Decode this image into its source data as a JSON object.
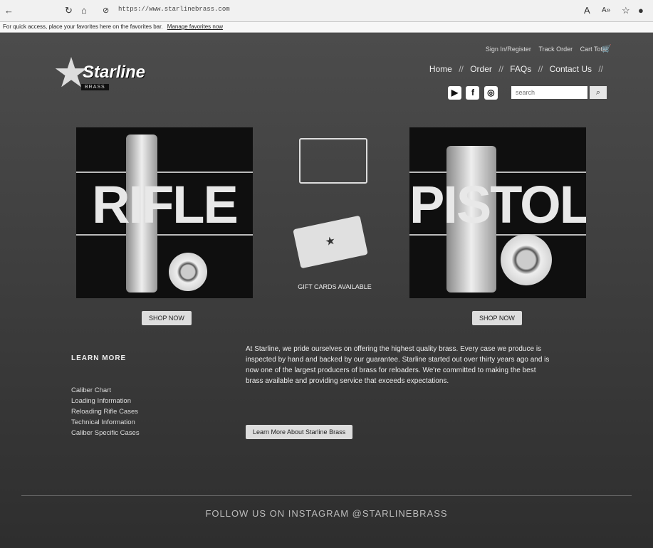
{
  "browser": {
    "back_icon": "arrow-left-icon",
    "reload_icon": "reload-icon",
    "home_icon": "home-icon",
    "url": "https://www.starlinebrass.com",
    "zoom_icon": "zoom-icon",
    "read_icon": "read-aloud-icon",
    "favorite_icon": "star-icon",
    "profile_icon": "profile-icon",
    "notice_text": "For quick access, place your favorites here on the favorites bar.",
    "notice_link": "Manage favorites now"
  },
  "header": {
    "account_links": [
      "Sign In/Register",
      "Track Order",
      "Cart Total"
    ],
    "nav": [
      "Home",
      "Order",
      "FAQs",
      "Contact Us"
    ],
    "nav_sep": "//",
    "social": [
      "youtube-icon",
      "facebook-icon",
      "instagram-icon"
    ],
    "search_placeholder": "search"
  },
  "logo": {
    "brand": "Starline",
    "tagline": "BRASS"
  },
  "products": {
    "rifle_word": "RIFLE",
    "pistol_word": "PISTOL",
    "shop_label": "SHOP NOW",
    "gift_caption": "GIFT CARDS AVAILABLE"
  },
  "learn_more": {
    "heading": "LEARN MORE",
    "items": [
      "Caliber Chart",
      "Loading Information",
      "Reloading Rifle Cases",
      "Technical Information",
      "Caliber Specific Cases"
    ]
  },
  "about": {
    "text": "At Starline, we pride ourselves on offering the highest quality brass. Every case we produce is inspected by hand and backed by our guarantee. Starline started out over thirty years ago and is now one of the largest producers of brass for reloaders. We're committed to making the best brass available and providing service that exceeds expectations.",
    "button": "Learn More About Starline Brass"
  },
  "footer": {
    "follow_text": "FOLLOW US ON INSTAGRAM @STARLINEBRASS"
  }
}
